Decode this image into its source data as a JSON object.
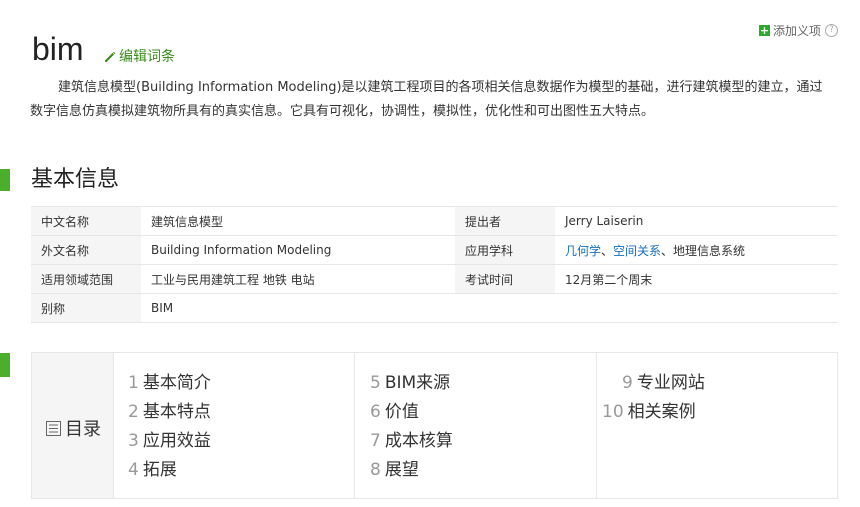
{
  "header": {
    "title": "bim",
    "edit_label": "编辑词条",
    "add_sense_label": "添加义项",
    "help_glyph": "?"
  },
  "summary": "建筑信息模型(Building Information Modeling)是以建筑工程项目的各项相关信息数据作为模型的基础，进行建筑模型的建立，通过数字信息仿真模拟建筑物所具有的真实信息。它具有可视化，协调性，模拟性，优化性和可出图性五大特点。",
  "basic_info": {
    "section_title": "基本信息",
    "rows": [
      {
        "label": "中文名称",
        "value": "建筑信息模型",
        "label2": "提出者",
        "value2": "Jerry Laiserin"
      },
      {
        "label": "外文名称",
        "value": "Building Information Modeling",
        "label2": "应用学科",
        "value2_links": [
          "几何学",
          "空间关系"
        ],
        "value2_sep": "、",
        "value2_tail": "、地理信息系统"
      },
      {
        "label": "适用领域范围",
        "value": "工业与民用建筑工程 地铁 电站",
        "label2": "考试时间",
        "value2": "12月第二个周末"
      },
      {
        "label": "别称",
        "value": "BIM",
        "label2": "",
        "value2": ""
      }
    ]
  },
  "toc": {
    "title": "目录",
    "columns": [
      [
        {
          "num": "1",
          "label": "基本简介"
        },
        {
          "num": "2",
          "label": "基本特点"
        },
        {
          "num": "3",
          "label": "应用效益"
        },
        {
          "num": "4",
          "label": "拓展"
        }
      ],
      [
        {
          "num": "5",
          "label": "BIM来源"
        },
        {
          "num": "6",
          "label": "价值"
        },
        {
          "num": "7",
          "label": "成本核算"
        },
        {
          "num": "8",
          "label": "展望"
        }
      ],
      [
        {
          "num": "9",
          "label": "专业网站"
        },
        {
          "num": "10",
          "label": "相关案例"
        }
      ]
    ]
  },
  "colors": {
    "accent_green": "#4caf2c",
    "edit_green": "#3a8b1c",
    "link_blue": "#136ec2",
    "table_label_bg": "#f5f5f5",
    "border": "#e6e6e6"
  },
  "icons": {
    "edit": "pencil-icon",
    "add": "plus-icon",
    "help": "question-circle-icon",
    "toc": "list-icon"
  }
}
